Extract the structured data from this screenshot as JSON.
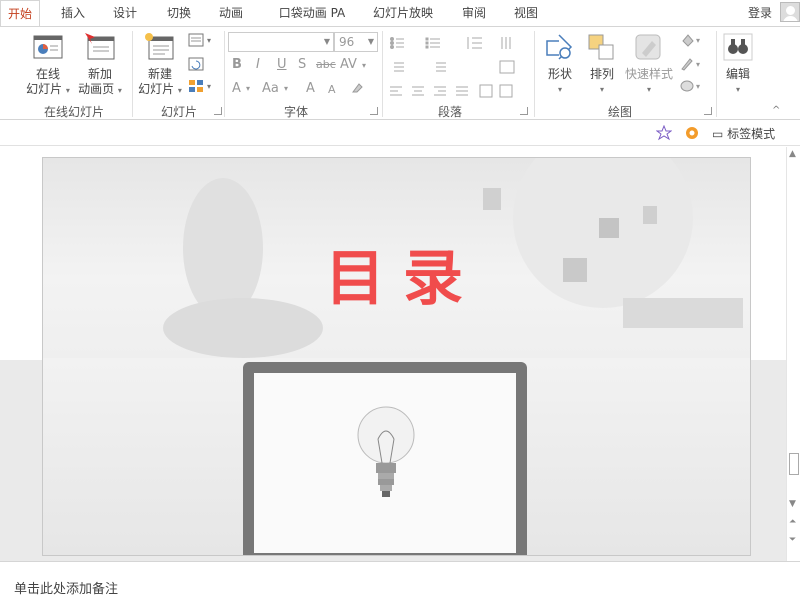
{
  "tabs": [
    {
      "label": "开始",
      "active": true
    },
    {
      "label": "插入"
    },
    {
      "label": "设计"
    },
    {
      "label": "切换"
    },
    {
      "label": "动画"
    },
    {
      "label": "口袋动画 PA"
    },
    {
      "label": "幻灯片放映"
    },
    {
      "label": "审阅"
    },
    {
      "label": "视图"
    }
  ],
  "account": {
    "login_label": "登录"
  },
  "ribbon": {
    "groups": {
      "online": {
        "label": "在线幻灯片",
        "buttons": [
          {
            "line1": "在线",
            "line2": "幻灯片"
          },
          {
            "line1": "新加",
            "line2": "动画页"
          }
        ]
      },
      "slides": {
        "label": "幻灯片",
        "new_slide": {
          "line1": "新建",
          "line2": "幻灯片"
        }
      },
      "font": {
        "label": "字体",
        "font_name": "",
        "font_size": "96",
        "format_buttons": [
          "B",
          "I",
          "U",
          "S",
          "abc",
          "AV",
          "A",
          "Aa",
          "A",
          "A"
        ]
      },
      "paragraph": {
        "label": "段落"
      },
      "drawing": {
        "label": "绘图",
        "buttons": [
          {
            "label": "形状"
          },
          {
            "label": "排列"
          },
          {
            "label": "快速样式"
          }
        ]
      },
      "editing": {
        "label": "编辑"
      }
    }
  },
  "subbar": {
    "tag_mode_label": "标签模式"
  },
  "slide": {
    "title": "目录"
  },
  "notes": {
    "placeholder": "单击此处添加备注"
  },
  "colors": {
    "accent": "#c43e1c",
    "title": "#f04c4c"
  }
}
